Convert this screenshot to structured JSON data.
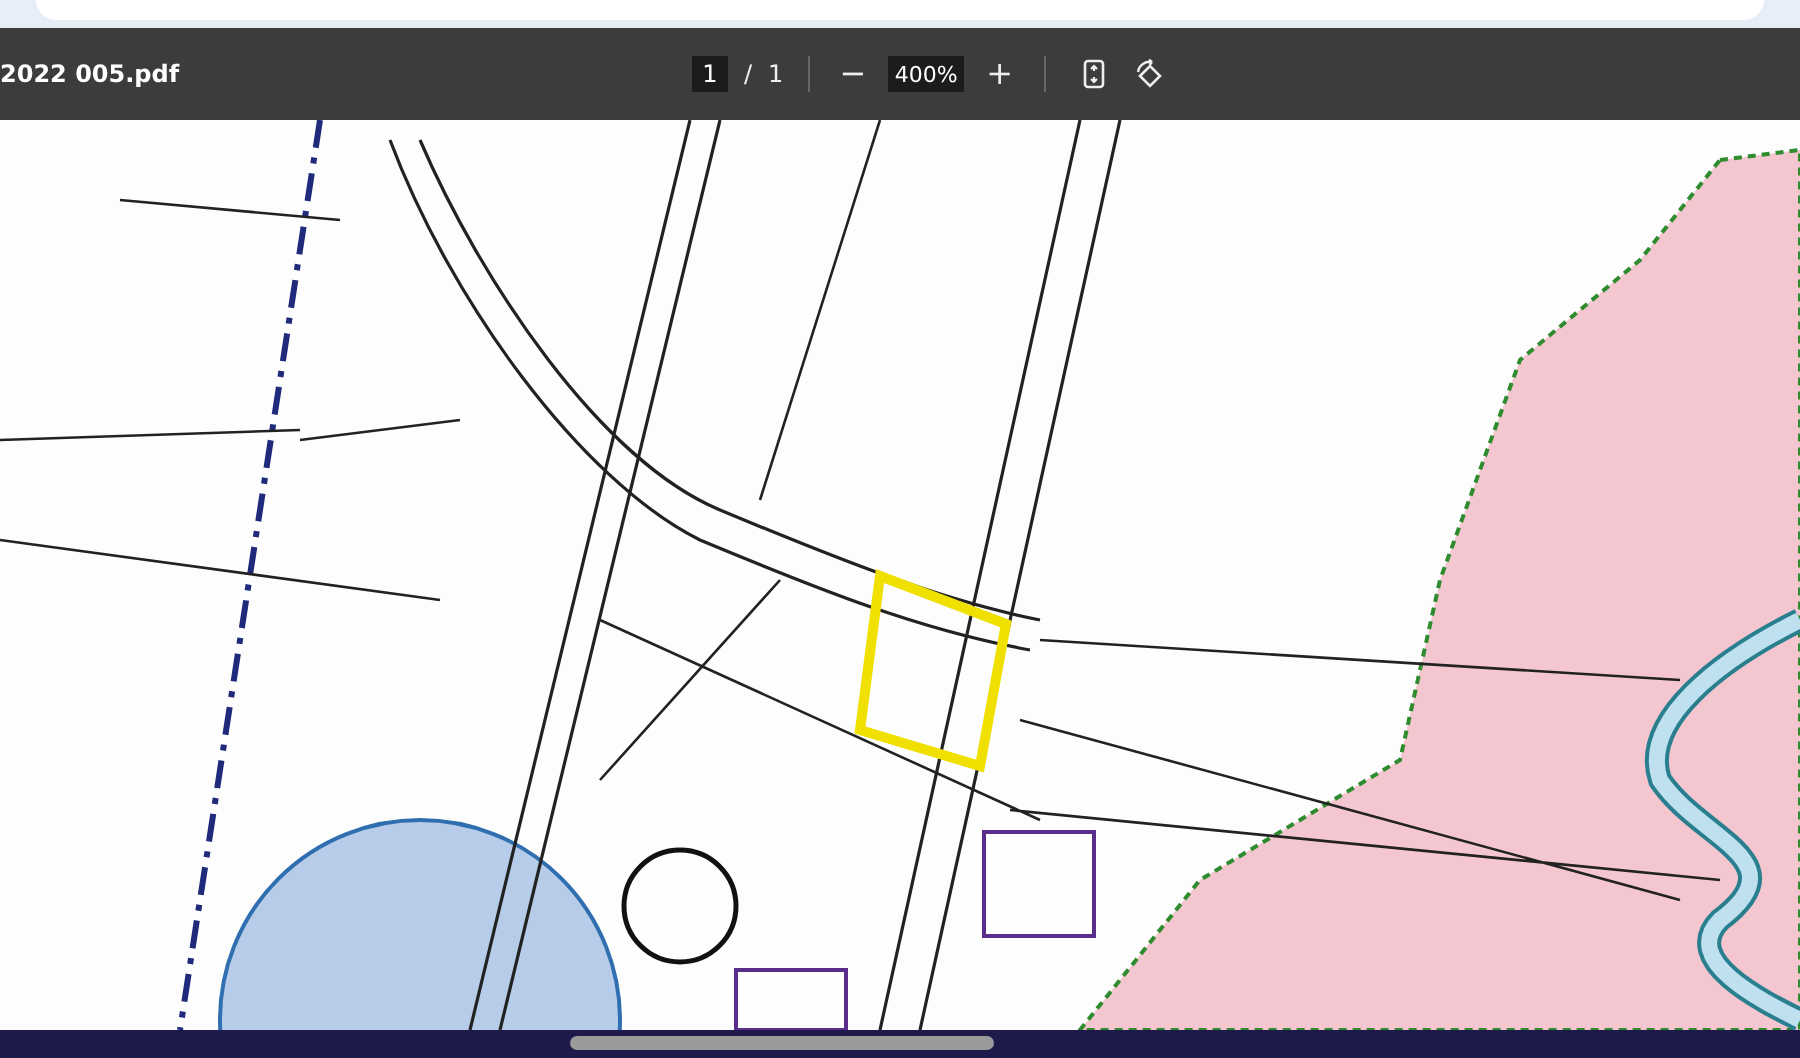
{
  "toolbar": {
    "title": "2022 005.pdf",
    "page": {
      "value": "1"
    },
    "page_separator": "/",
    "page_count": "1",
    "zoom_out": "−",
    "zoom": {
      "value": "400%"
    },
    "zoom_in": "+"
  },
  "document": {
    "kind": "map"
  }
}
